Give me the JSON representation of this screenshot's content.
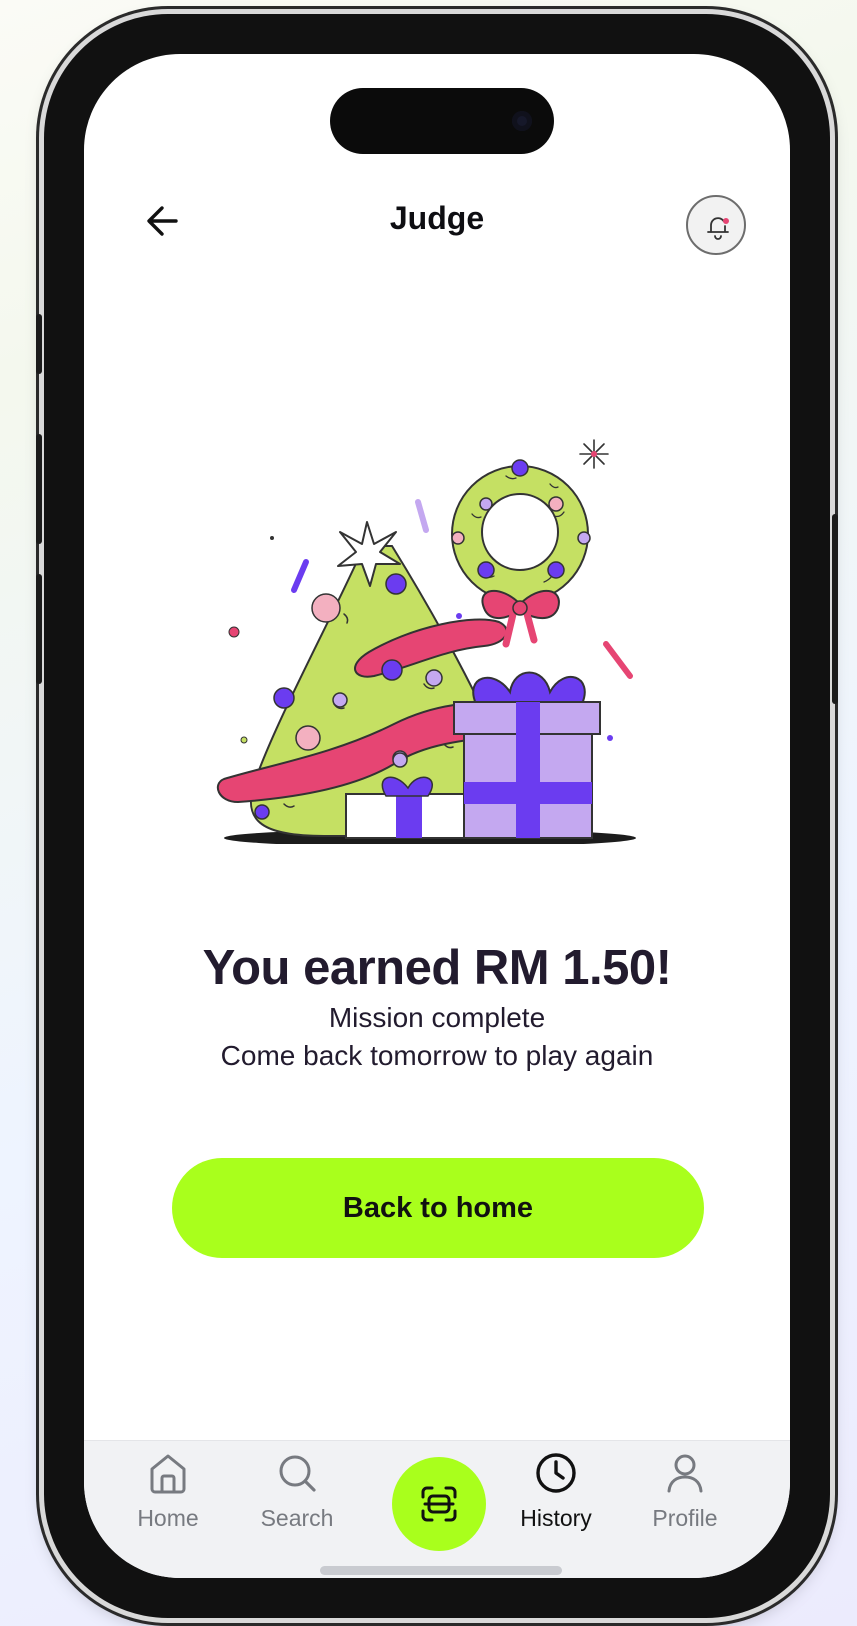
{
  "header": {
    "title": "Judge"
  },
  "reward": {
    "headline": "You earned RM 1.50!",
    "line1": "Mission complete",
    "line2": "Come back tomorrow to play again"
  },
  "actions": {
    "back_home_label": "Back to home"
  },
  "tabbar": {
    "active": "History",
    "items": [
      {
        "label": "Home",
        "icon": "home-icon"
      },
      {
        "label": "Search",
        "icon": "search-icon"
      },
      {
        "label": "History",
        "icon": "clock-icon"
      },
      {
        "label": "Profile",
        "icon": "user-icon"
      }
    ],
    "center_icon": "scan-icon"
  },
  "colors": {
    "accent": "#a9ff1c",
    "text": "#221b2e",
    "tree_green": "#c5e063",
    "ribbon_pink": "#e64573",
    "gift_purple": "#6b3cf0",
    "gift_lavender": "#c4a8f0"
  }
}
